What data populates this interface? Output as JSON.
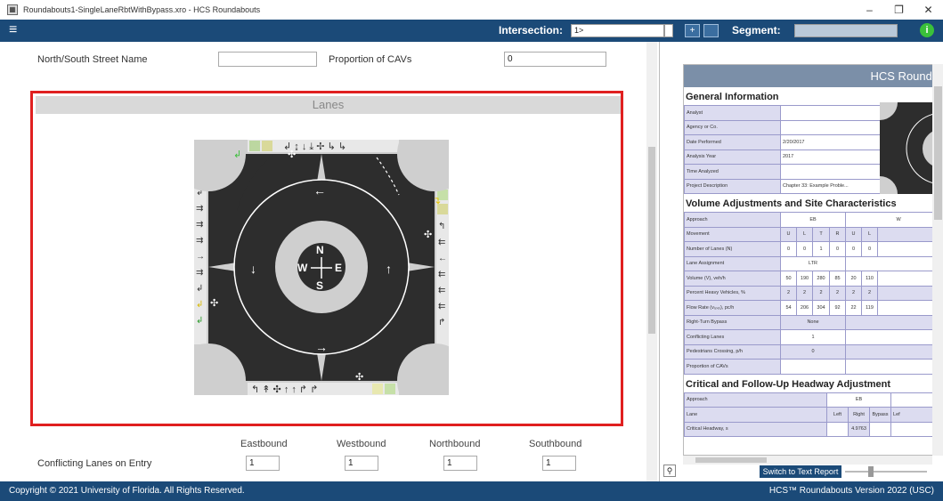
{
  "window": {
    "title": "Roundabouts1-SingleLaneRbtWithBypass.xro - HCS Roundabouts",
    "minimize_glyph": "–",
    "restore_glyph": "❐",
    "close_glyph": "✕"
  },
  "topbar": {
    "menu_glyph": "≡",
    "intersection_label": "Intersection:",
    "intersection_value": "1>",
    "add_glyph": "+",
    "segment_label": "Segment:",
    "segment_value": "",
    "info_glyph": "i"
  },
  "form": {
    "ns_street_label": "North/South Street Name",
    "ns_street_value": "",
    "cav_label": "Proportion of CAVs",
    "cav_value": "0",
    "lanes_header": "Lanes",
    "compass": {
      "n": "N",
      "s": "S",
      "e": "E",
      "w": "W"
    },
    "directions": [
      "Eastbound",
      "Westbound",
      "Northbound",
      "Southbound"
    ],
    "conflicting_label": "Conflicting Lanes on Entry",
    "conflicting_values": [
      "1",
      "1",
      "1",
      "1"
    ]
  },
  "report": {
    "header": "HCS Roundal",
    "general_title": "General Information",
    "general_rows": [
      {
        "label": "Analyst",
        "value": ""
      },
      {
        "label": "Agency or Co.",
        "value": ""
      },
      {
        "label": "Date Performed",
        "value": "2/20/2017"
      },
      {
        "label": "Analysis Year",
        "value": "2017"
      },
      {
        "label": "Time Analyzed",
        "value": ""
      },
      {
        "label": "Project Description",
        "value": "Chapter 33: Example Proble..."
      }
    ],
    "volume_title": "Volume Adjustments and Site Characteristics",
    "approach_label": "Approach",
    "approach_eb": "EB",
    "approach_wb": "W",
    "movement_label": "Movement",
    "movements": [
      "U",
      "L",
      "T",
      "R",
      "U",
      "L"
    ],
    "volume_rows": [
      {
        "label": "Number of Lanes (N)",
        "cells": [
          "0",
          "0",
          "1",
          "0",
          "0",
          "0"
        ]
      },
      {
        "label": "Lane Assignment",
        "span": "LTR"
      },
      {
        "label": "Volume (V), veh/h",
        "cells": [
          "50",
          "190",
          "280",
          "85",
          "20",
          "110"
        ]
      },
      {
        "label": "Percent Heavy Vehicles, %",
        "cells": [
          "2",
          "2",
          "2",
          "2",
          "2",
          "2"
        ]
      },
      {
        "label": "Flow Rate (v₍ₚₑ₎), pc/h",
        "cells": [
          "54",
          "206",
          "304",
          "92",
          "22",
          "119"
        ]
      },
      {
        "label": "Right-Turn Bypass",
        "span": "None",
        "right": "Yield"
      },
      {
        "label": "Conflicting Lanes",
        "span": "1",
        "right": "1"
      },
      {
        "label": "Pedestrians Crossing, p/h",
        "span": "0",
        "right": "0"
      },
      {
        "label": "Proportion of CAVs",
        "span": "",
        "right": ""
      }
    ],
    "headway_title": "Critical and Follow-Up Headway Adjustment",
    "headway_approach_label": "Approach",
    "headway_approach_value": "EB",
    "headway_lane_label": "Lane",
    "headway_lanes": [
      "Left",
      "Right",
      "Bypass",
      "Lef"
    ],
    "headway_crit_label": "Critical Headway, s",
    "headway_crit_values": [
      "",
      "4.9763",
      "",
      ""
    ],
    "zoom_glyph": "⚲",
    "switch_label": "Switch to Text Report"
  },
  "footer": {
    "copyright": "Copyright © 2021 University of Florida. All Rights Reserved.",
    "version": "HCS™ Roundabouts Version 2022 (USC)"
  },
  "colors": {
    "brand_blue": "#1b4a78",
    "highlight_red": "#e02020",
    "info_green": "#3ac03a",
    "report_label_bg": "#dcdcf0"
  }
}
